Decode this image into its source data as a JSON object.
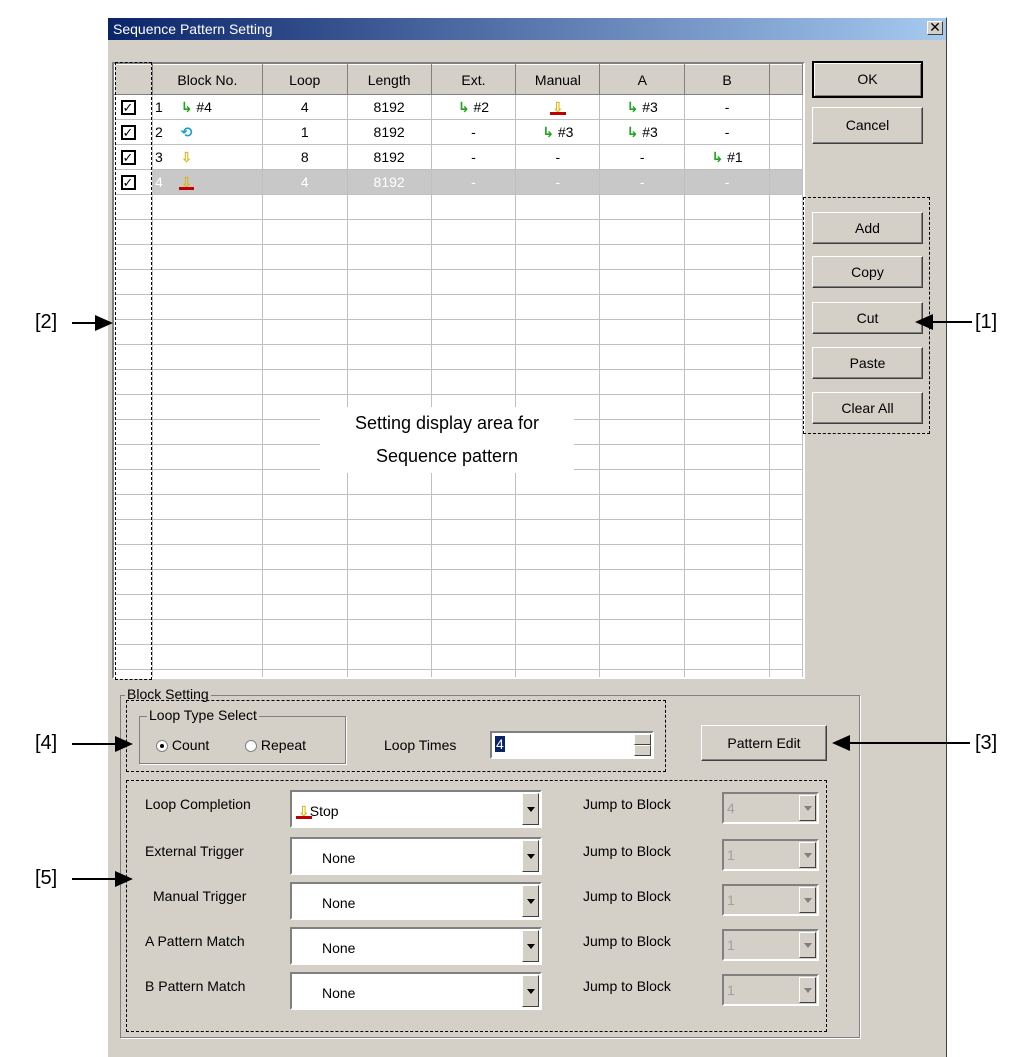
{
  "window": {
    "title": "Sequence Pattern Setting",
    "close_glyph": "✕"
  },
  "table": {
    "headers": [
      "",
      "Block No.",
      "Loop",
      "Length",
      "Ext.",
      "Manual",
      "A",
      "B",
      ""
    ],
    "rows": [
      {
        "checked": true,
        "no": "1",
        "icon": "jump-icon",
        "target": "#4",
        "loop": "4",
        "length": "8192",
        "ext": {
          "icon": "jump-icon",
          "text": "#2"
        },
        "manual": {
          "icon": "stop-icon",
          "text": ""
        },
        "a": {
          "icon": "jump-icon",
          "text": "#3"
        },
        "b": {
          "icon": "",
          "text": "-"
        }
      },
      {
        "checked": true,
        "no": "2",
        "icon": "repeat-icon",
        "target": "",
        "loop": "1",
        "length": "8192",
        "ext": {
          "icon": "",
          "text": "-"
        },
        "manual": {
          "icon": "jump-icon",
          "text": "#3"
        },
        "a": {
          "icon": "jump-icon",
          "text": "#3"
        },
        "b": {
          "icon": "",
          "text": "-"
        }
      },
      {
        "checked": true,
        "no": "3",
        "icon": "next-icon",
        "target": "",
        "loop": "8",
        "length": "8192",
        "ext": {
          "icon": "",
          "text": "-"
        },
        "manual": {
          "icon": "",
          "text": "-"
        },
        "a": {
          "icon": "",
          "text": "-"
        },
        "b": {
          "icon": "jump-icon",
          "text": "#1"
        }
      },
      {
        "checked": true,
        "no": "4",
        "icon": "stop-icon",
        "target": "",
        "loop": "4",
        "length": "8192",
        "ext": {
          "icon": "",
          "text": "-"
        },
        "manual": {
          "icon": "",
          "text": "-"
        },
        "a": {
          "icon": "",
          "text": "-"
        },
        "b": {
          "icon": "",
          "text": "-"
        },
        "selected": true
      }
    ],
    "empty_rows": 20,
    "overlay_line1": "Setting display area for",
    "overlay_line2": "Sequence  pattern"
  },
  "buttons": {
    "ok": "OK",
    "cancel": "Cancel",
    "add": "Add",
    "copy": "Copy",
    "cut": "Cut",
    "paste": "Paste",
    "clear_all": "Clear All",
    "pattern_edit": "Pattern Edit"
  },
  "block_setting": {
    "label": "Block Setting",
    "loop_type_label": "Loop Type Select",
    "count_label": "Count",
    "repeat_label": "Repeat",
    "loop_type_selected": "Count",
    "loop_times_label": "Loop Times",
    "loop_times_value": "4",
    "rows": [
      {
        "label": "Loop Completion",
        "value": "Stop",
        "icon": "stop-icon",
        "jump_label": "Jump to Block",
        "jump_value": "4"
      },
      {
        "label": "External Trigger",
        "value": "None",
        "icon": "",
        "jump_label": "Jump to Block",
        "jump_value": "1"
      },
      {
        "label": "Manual Trigger",
        "value": "None",
        "icon": "",
        "jump_label": "Jump to Block",
        "jump_value": "1"
      },
      {
        "label": "A Pattern Match",
        "value": "None",
        "icon": "",
        "jump_label": "Jump to Block",
        "jump_value": "1"
      },
      {
        "label": "B Pattern Match",
        "value": "None",
        "icon": "",
        "jump_label": "Jump to Block",
        "jump_value": "1"
      }
    ]
  },
  "callouts": {
    "c1": "[1]",
    "c2": "[2]",
    "c3": "[3]",
    "c4": "[4]",
    "c5": "[5]"
  },
  "glyphs": {
    "jump-icon": "↳",
    "stop-icon": "⇩",
    "next-icon": "⇩",
    "repeat-icon": "⟲"
  }
}
